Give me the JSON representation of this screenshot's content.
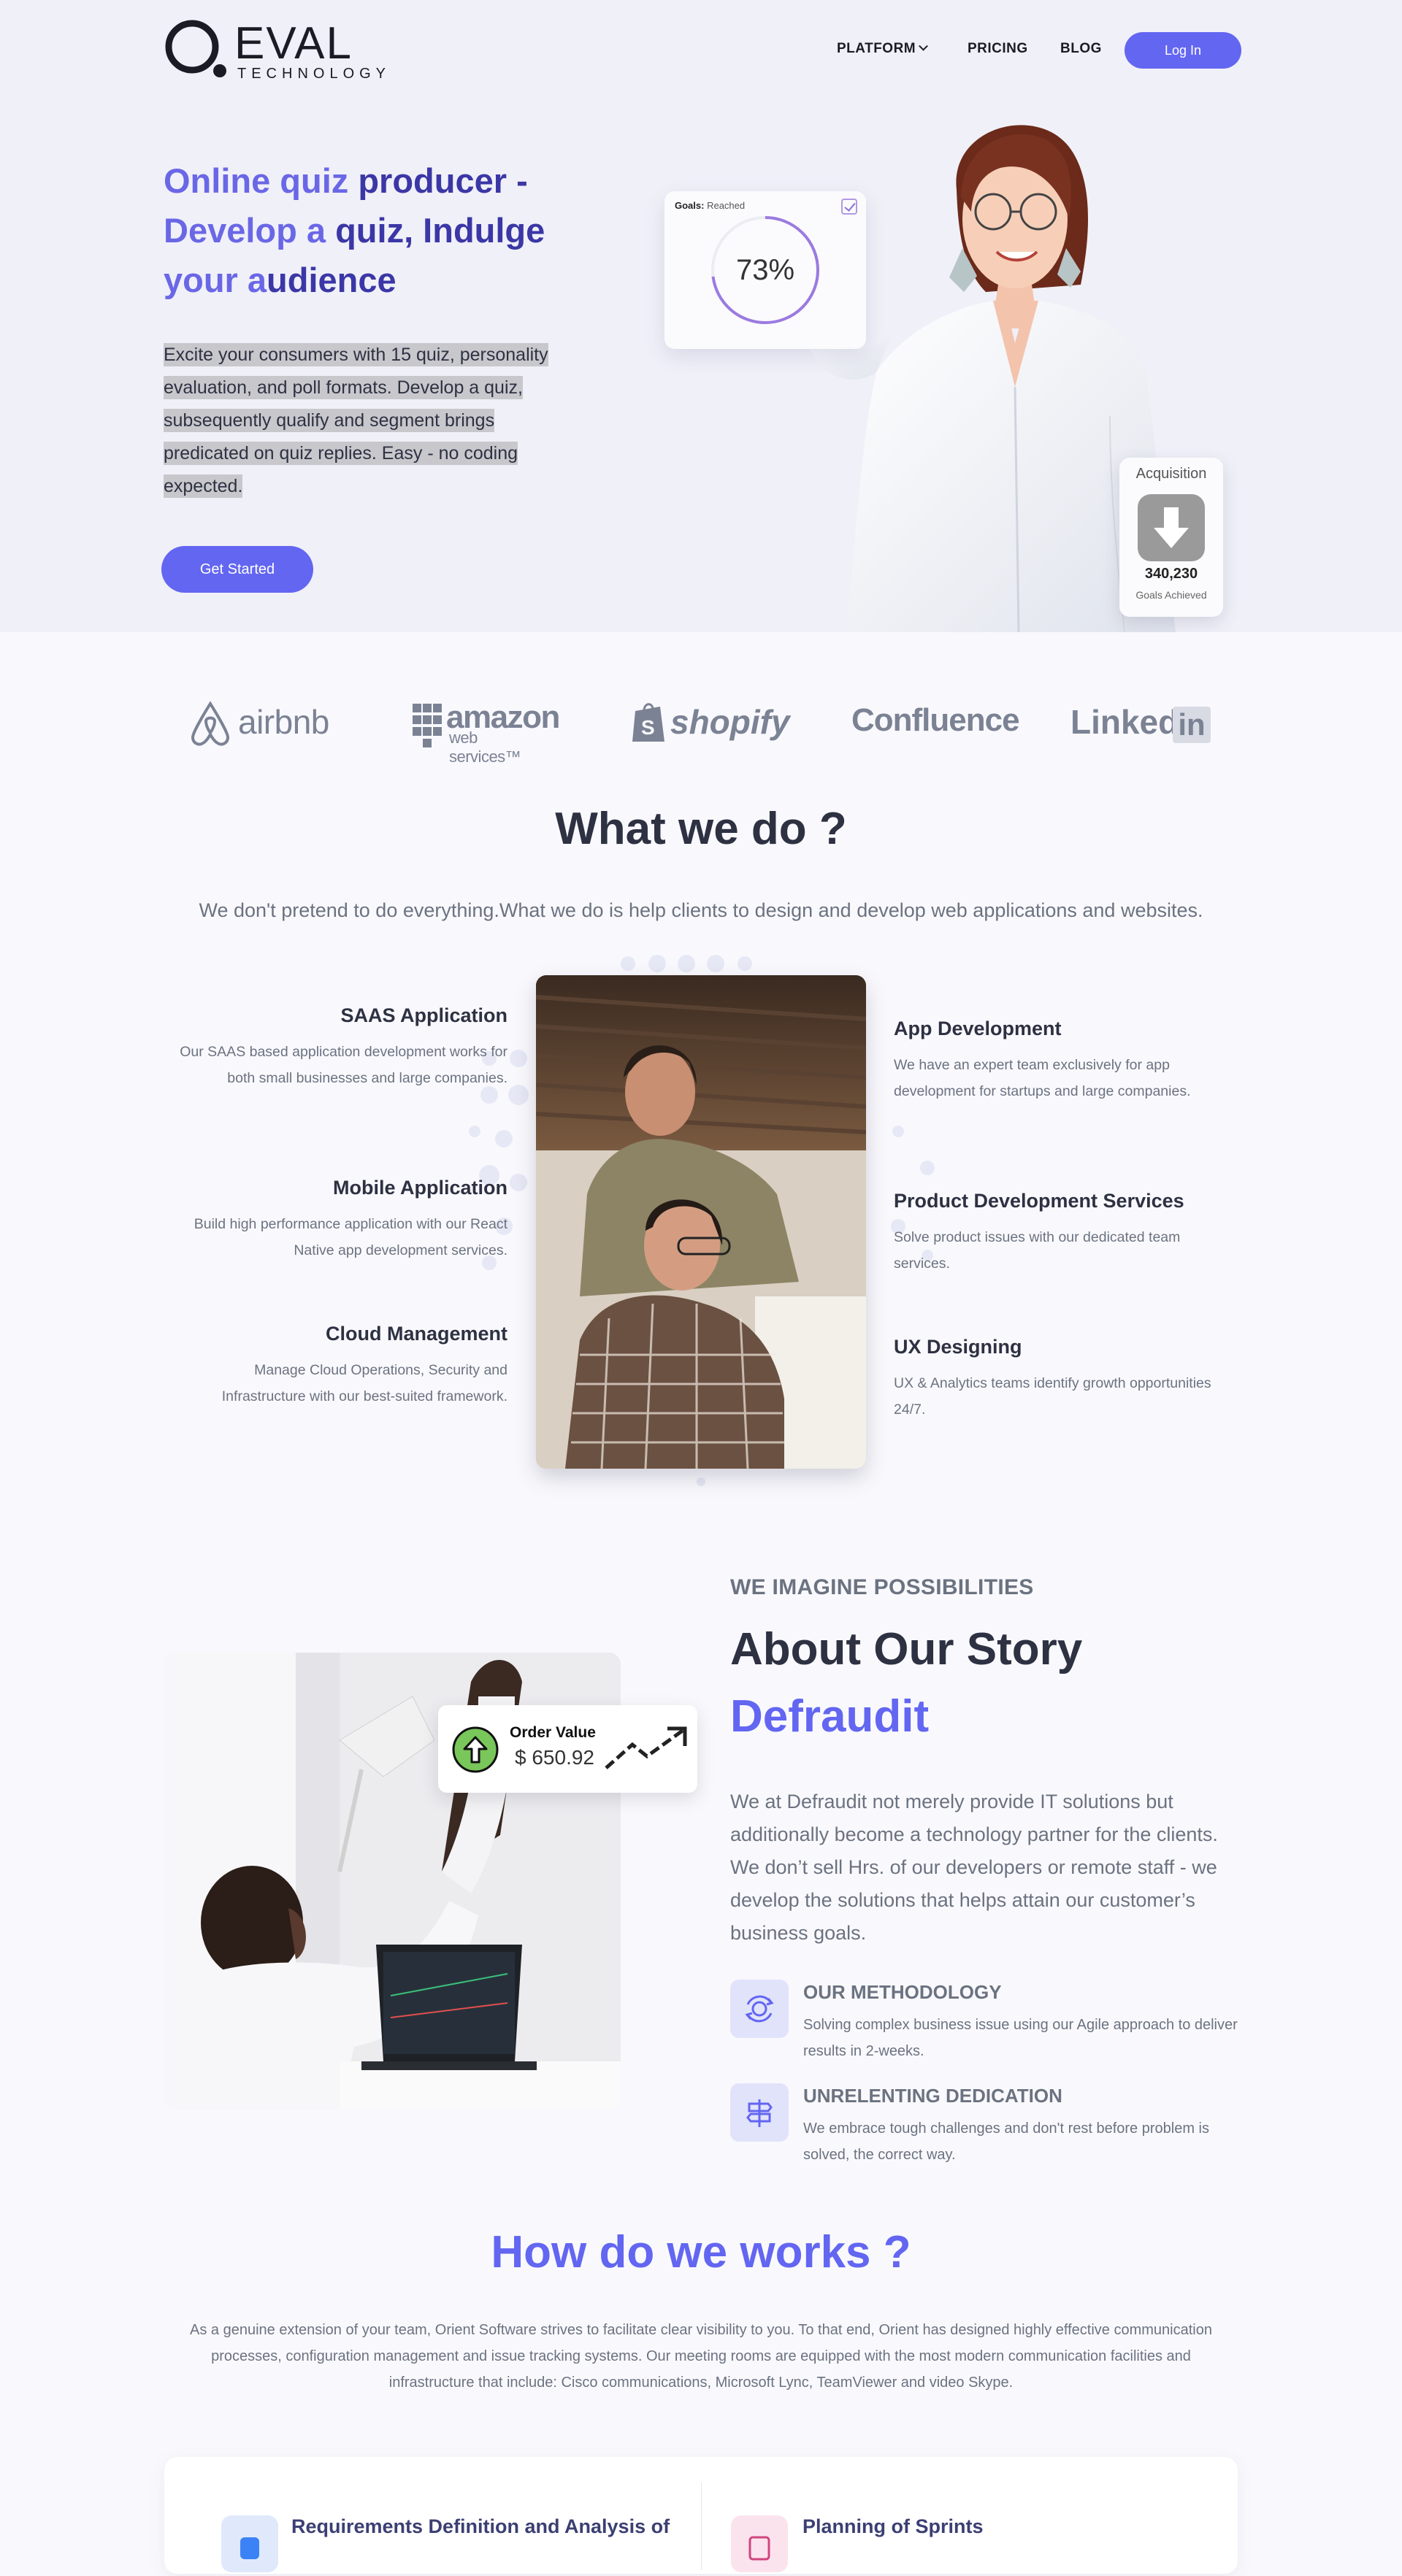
{
  "header": {
    "logo_word": "EVAL",
    "logo_sub": "TECHNOLOGY",
    "nav": {
      "platform": "PLATFORM",
      "pricing": "PRICING",
      "blog": "BLOG"
    },
    "login": "Log In"
  },
  "hero": {
    "title_light_1": "Online quiz ",
    "title_dark_1": "producer -",
    "title_light_2": "Develop a ",
    "title_dark_2": "quiz, Indulge",
    "title_light_3": "your a",
    "title_dark_3": "udience",
    "description": "Excite your consumers with 15 quiz, personality evaluation, and poll formats. Develop a quiz, subsequently qualify and segment brings predicated on quiz replies. Easy - no coding expected.",
    "cta": "Get Started",
    "goals_card": {
      "label_bold": "Goals:",
      "label": " Reached",
      "value": "73%",
      "progress": 0.73
    },
    "acquisition_card": {
      "title": "Acquisition",
      "value": "340,230",
      "subtitle": "Goals Achieved"
    }
  },
  "brands": {
    "airbnb": "airbnb",
    "amazon": "amazon",
    "amazon_sub": "web services™",
    "shopify": "shopify",
    "confluence": "Confluence",
    "linkedin": "Linked",
    "linkedin_in": "in"
  },
  "what_we_do": {
    "title": "What we do ?",
    "description": "We don't pretend to do everything.What we do is help clients to design and develop web applications and websites.",
    "services_left": [
      {
        "title": "SAAS Application",
        "text": "Our SAAS based application development works for both small businesses and large companies."
      },
      {
        "title": "Mobile Application",
        "text": "Build high performance application with our React Native app development services."
      },
      {
        "title": "Cloud Management",
        "text": "Manage Cloud Operations, Security and Infrastructure with our best-suited framework."
      }
    ],
    "services_right": [
      {
        "title": "App Development",
        "text": "We have an expert team exclusively for app development for startups and large companies."
      },
      {
        "title": "Product Development Services",
        "text": "Solve product issues with our dedicated team services."
      },
      {
        "title": "UX Designing",
        "text": "UX & Analytics teams identify growth opportunities 24/7."
      }
    ]
  },
  "about": {
    "eyebrow": "WE IMAGINE POSSIBILITIES",
    "title": "About Our Story",
    "subtitle": "Defraudit",
    "text": "We at Defraudit not merely provide IT solutions but additionally become a technology partner for the clients. We don’t sell Hrs. of our developers or remote staff - we develop the solutions that helps attain our customer’s business goals.",
    "order_card": {
      "label": "Order Value",
      "value": "$ 650.92"
    },
    "features": [
      {
        "title": "OUR METHODOLOGY",
        "text": "Solving complex business issue using our Agile approach to deliver results in 2-weeks."
      },
      {
        "title": "UNRELENTING DEDICATION",
        "text": "We embrace tough challenges and don't rest before problem is solved, the correct way."
      }
    ]
  },
  "how_we_work": {
    "title": "How do we works ?",
    "description": "As a genuine extension of your team, Orient Software strives to facilitate clear visibility to you. To that end, Orient has designed highly effective communication processes, configuration management and issue tracking systems. Our meeting rooms are equipped with the most modern communication facilities and infrastructure that include: Cisco communications, Microsoft Lync, TeamViewer and video Skype.",
    "steps": [
      {
        "title": "Requirements Definition and Analysis of"
      },
      {
        "title": "Planning of Sprints"
      }
    ]
  },
  "colors": {
    "accent": "#6366f1",
    "hero_bg": "#f0f0f8",
    "page_bg": "#f9f9fd",
    "heading": "#2d3142",
    "muted": "#6b7280"
  }
}
